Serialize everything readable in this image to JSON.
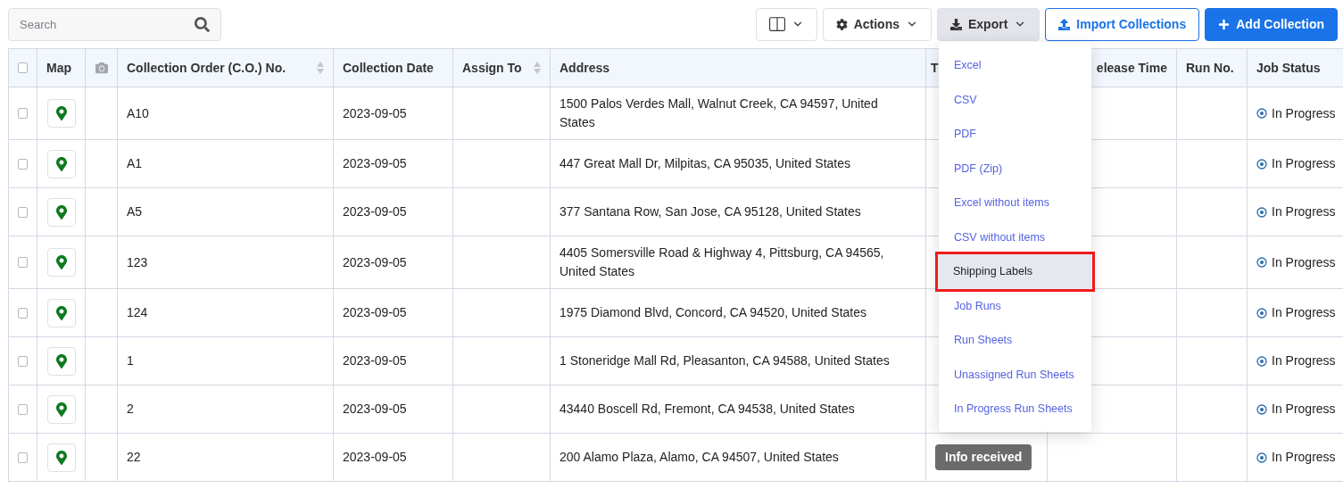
{
  "search": {
    "placeholder": "Search"
  },
  "toolbar": {
    "actions": "Actions",
    "export": "Export",
    "import": "Import Collections",
    "add": "Add Collection"
  },
  "export_menu": [
    {
      "label": "Excel",
      "selected": false
    },
    {
      "label": "CSV",
      "selected": false
    },
    {
      "label": "PDF",
      "selected": false
    },
    {
      "label": "PDF (Zip)",
      "selected": false
    },
    {
      "label": "Excel without items",
      "selected": false
    },
    {
      "label": "CSV without items",
      "selected": false
    },
    {
      "label": "Shipping Labels",
      "selected": true
    },
    {
      "label": "Job Runs",
      "selected": false
    },
    {
      "label": "Run Sheets",
      "selected": false
    },
    {
      "label": "Unassigned Run Sheets",
      "selected": false
    },
    {
      "label": "In Progress Run Sheets",
      "selected": false
    }
  ],
  "table": {
    "columns": [
      {
        "kind": "checkbox",
        "checked": false
      },
      {
        "kind": "text",
        "label": "Map"
      },
      {
        "kind": "camera"
      },
      {
        "kind": "text",
        "label": "Collection Order (C.O.) No.",
        "sortable": true
      },
      {
        "kind": "text",
        "label": "Collection Date"
      },
      {
        "kind": "text",
        "label": "Assign To",
        "sortable": true
      },
      {
        "kind": "text",
        "label": "Address"
      },
      {
        "kind": "text",
        "label": "T"
      },
      {
        "kind": "text",
        "label": "elease Time"
      },
      {
        "kind": "text",
        "label": "Run No."
      },
      {
        "kind": "text",
        "label": "Job Status"
      }
    ],
    "rows": [
      {
        "checked": false,
        "order_no": "A10",
        "date": "2023-09-05",
        "address": "1500 Palos Verdes Mall, Walnut Creek, CA 94597, United States",
        "job_status": "In Progress"
      },
      {
        "checked": false,
        "order_no": "A1",
        "date": "2023-09-05",
        "address": "447 Great Mall Dr, Milpitas, CA 95035, United States",
        "job_status": "In Progress"
      },
      {
        "checked": false,
        "order_no": "A5",
        "date": "2023-09-05",
        "address": "377 Santana Row, San Jose, CA 95128, United States",
        "job_status": "In Progress"
      },
      {
        "checked": false,
        "order_no": "123",
        "date": "2023-09-05",
        "address": "4405 Somersville Road & Highway 4, Pittsburg, CA 94565, United States",
        "job_status": "In Progress"
      },
      {
        "checked": false,
        "order_no": "124",
        "date": "2023-09-05",
        "address": "1975 Diamond Blvd, Concord, CA 94520, United States",
        "job_status": "In Progress"
      },
      {
        "checked": false,
        "order_no": "1",
        "date": "2023-09-05",
        "address": "1 Stoneridge Mall Rd, Pleasanton, CA 94588, United States",
        "job_status": "In Progress"
      },
      {
        "checked": false,
        "order_no": "2",
        "date": "2023-09-05",
        "address": "43440 Boscell Rd, Fremont, CA 94538, United States",
        "job_status": "In Progress"
      },
      {
        "checked": false,
        "order_no": "22",
        "date": "2023-09-05",
        "address": "200 Alamo Plaza, Alamo, CA 94507, United States",
        "status_badge": "Info received",
        "job_status": "In Progress"
      }
    ]
  }
}
